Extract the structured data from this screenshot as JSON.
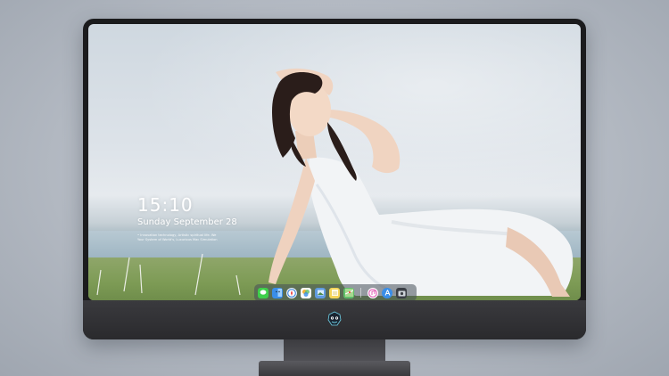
{
  "lock_screen": {
    "time": "15:10",
    "date": "Sunday September 28",
    "notes": [
      "• Innovation technology, Artistic spiritual life. We",
      "  Your System of World's, Luxurious Mac Simulation"
    ]
  },
  "dock": {
    "apps": [
      {
        "name": "messages-icon",
        "color": "#3ecf4a"
      },
      {
        "name": "finder-icon",
        "color": "#3a8ee8"
      },
      {
        "name": "safari-icon",
        "color": "#e9eef3"
      },
      {
        "name": "photos-icon",
        "color": "#f4b33d"
      },
      {
        "name": "preview-icon",
        "color": "#5f9be0"
      },
      {
        "name": "notes-icon",
        "color": "#f5d65a"
      },
      {
        "name": "maps-icon",
        "color": "#5fbf6a"
      }
    ],
    "apps_right": [
      {
        "name": "itunes-icon",
        "color": "#e04fb0"
      },
      {
        "name": "app-store-icon",
        "color": "#3a8ee8"
      },
      {
        "name": "camera-icon",
        "color": "#3b3f46"
      }
    ]
  },
  "colors": {
    "bezel": "#1b1b1d",
    "chin": "#2f2f33",
    "clock_text": "#ffffff"
  }
}
